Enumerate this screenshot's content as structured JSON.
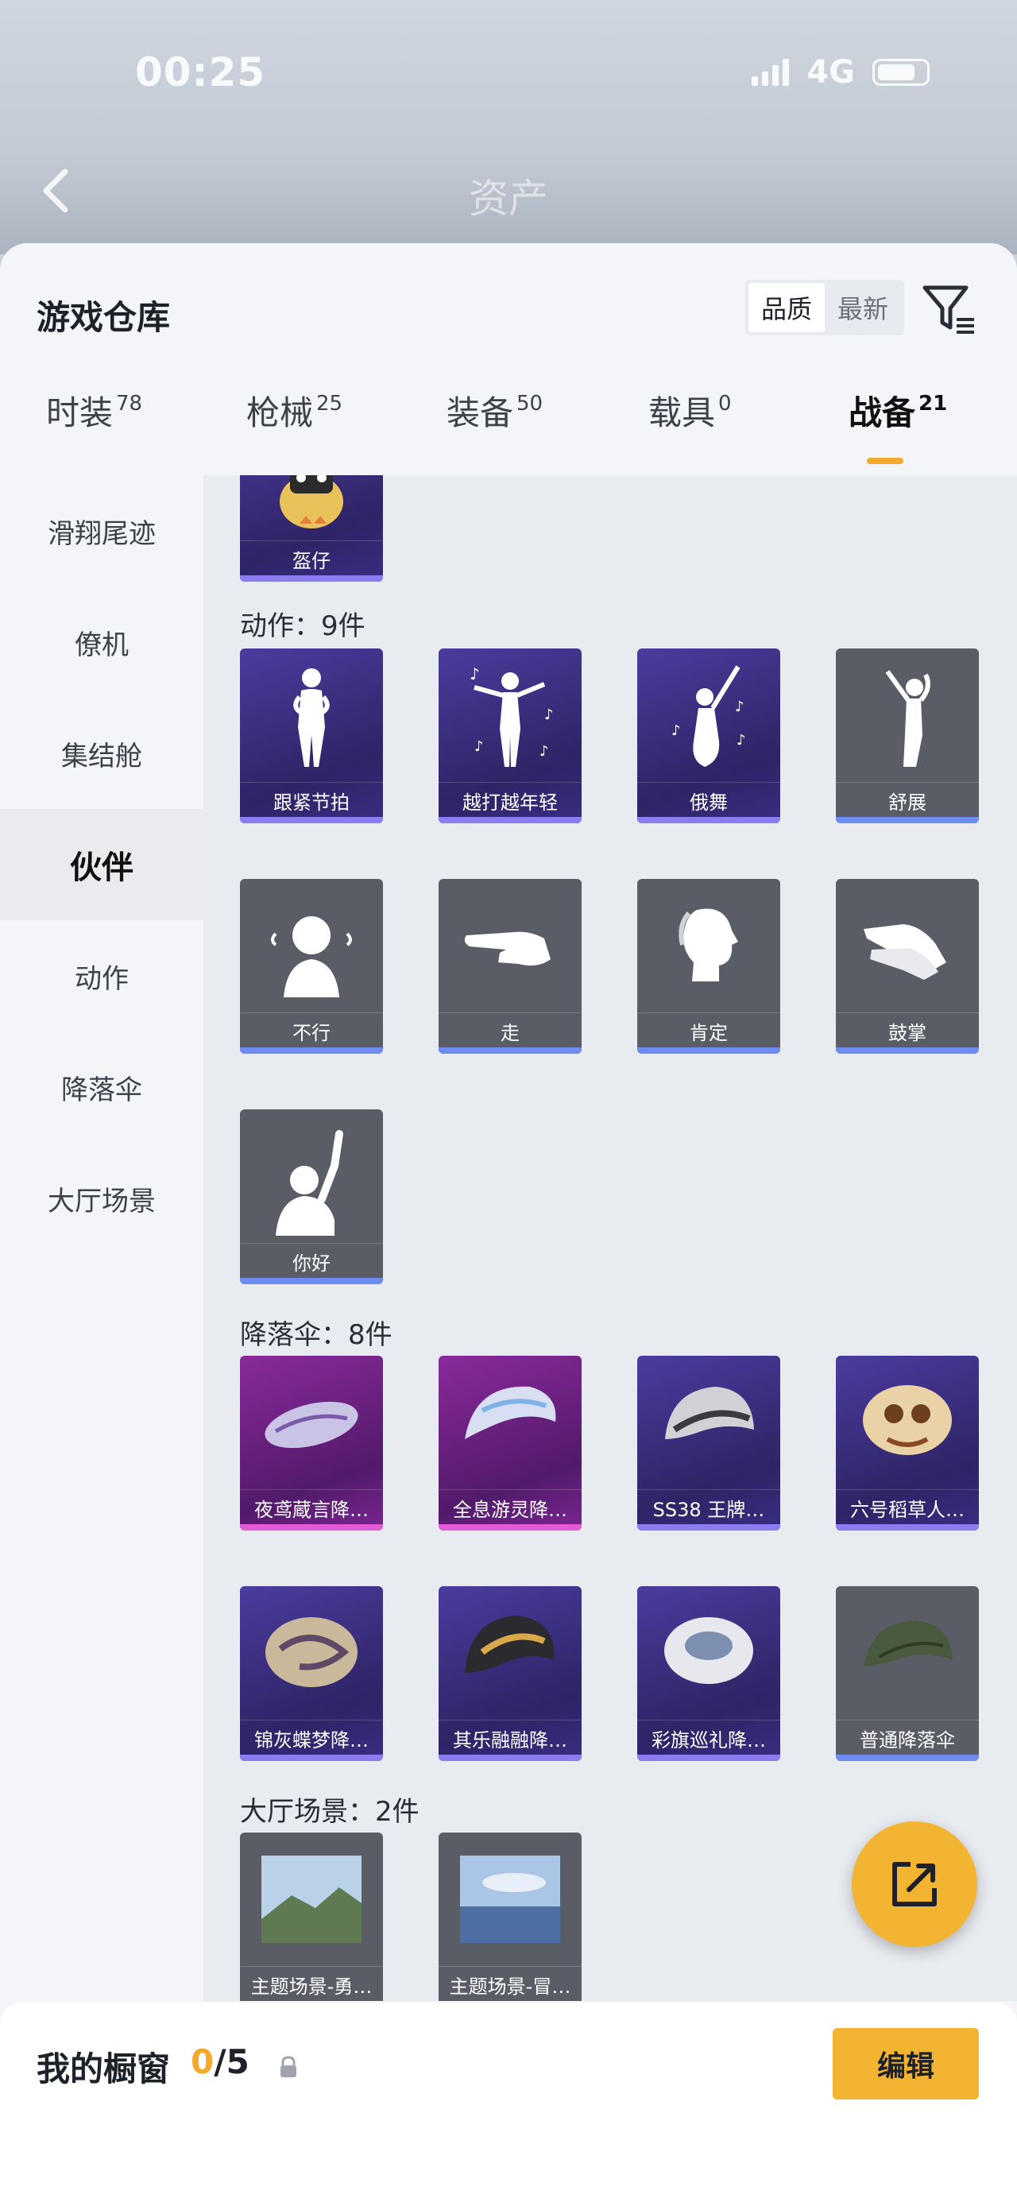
{
  "status_bar": {
    "time": "00:25",
    "network": "4G"
  },
  "background": {
    "title": "资产"
  },
  "header": {
    "title": "游戏仓库",
    "sort_options": [
      "品质",
      "最新"
    ],
    "sort_active": "品质"
  },
  "tabs": [
    {
      "label": "时装",
      "count": "78"
    },
    {
      "label": "枪械",
      "count": "25"
    },
    {
      "label": "装备",
      "count": "50"
    },
    {
      "label": "载具",
      "count": "0"
    },
    {
      "label": "战备",
      "count": "21"
    }
  ],
  "sidebar": {
    "items": [
      "滑翔尾迹",
      "僚机",
      "集结舱",
      "伙伴",
      "动作",
      "降落伞",
      "大厅场景"
    ],
    "active": "伙伴"
  },
  "sections": {
    "companion_tail": {
      "card_label": "盔仔"
    },
    "actions": {
      "title": "动作：9件",
      "items": [
        "跟紧节拍",
        "越打越年轻",
        "俄舞",
        "舒展",
        "不行",
        "走",
        "肯定",
        "鼓掌",
        "你好"
      ]
    },
    "parachutes": {
      "title": "降落伞：8件",
      "items": [
        "夜鸢蔵言降…",
        "全息游灵降…",
        "SS38 王牌…",
        "六号稻草人…",
        "锦灰蝶梦降…",
        "其乐融融降…",
        "彩旗巡礼降…",
        "普通降落伞"
      ]
    },
    "lobby": {
      "title": "大厅场景：2件",
      "items": [
        "主题场景-勇…",
        "主题场景-冒…"
      ]
    }
  },
  "showcase": {
    "title": "我的橱窗",
    "current": "0",
    "max": "/5",
    "edit_label": "编辑"
  },
  "colors": {
    "accent": "#f3b431",
    "purple_card": "#3a2d84",
    "pink_card": "#7b2694",
    "gray_card": "#5b5d66"
  }
}
